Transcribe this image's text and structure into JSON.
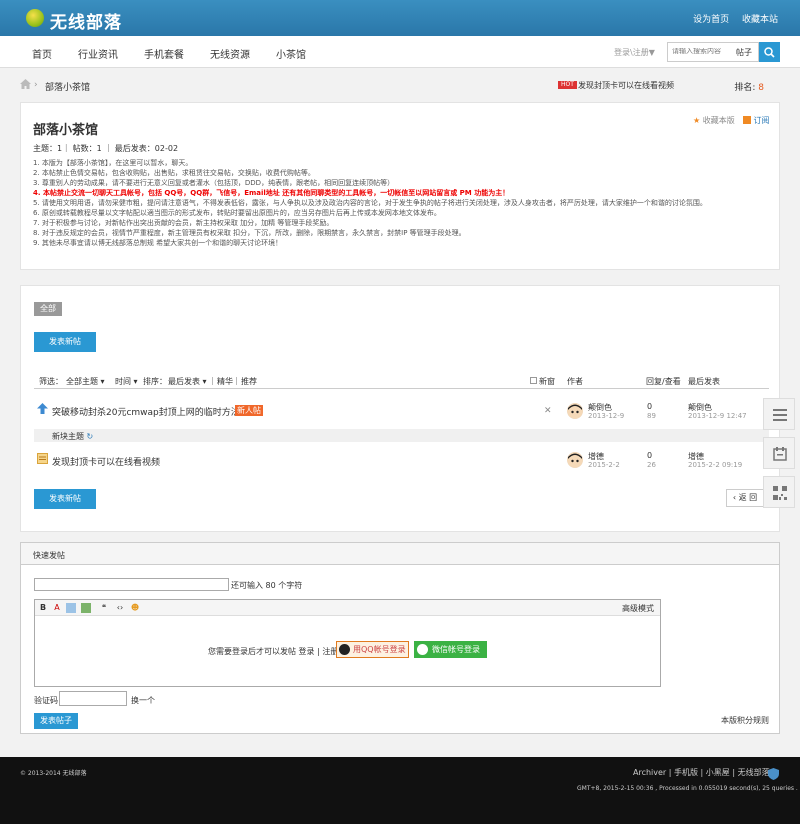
{
  "header": {
    "logo_text": "无线部落",
    "set_home": "设为首页",
    "favorite": "收藏本站"
  },
  "nav": {
    "items": [
      "首页",
      "行业资讯",
      "手机套餐",
      "无线资源",
      "小茶馆"
    ],
    "login_select": "登录\\注册▼",
    "search_placeholder": "请输入搜索内容",
    "search_type": "帖子"
  },
  "breadcrumb": {
    "sep": "›",
    "forum": "部落小茶馆"
  },
  "hot": {
    "badge": "HOT",
    "text": "发现封顶卡可以在线看视频"
  },
  "rank": {
    "label": "排名:",
    "value": "8"
  },
  "forum": {
    "title": "部落小茶馆",
    "fav": "收藏本版",
    "rss": "订阅",
    "stats": "主题：1｜ 帖数：1 ｜ 最后发表：02-02",
    "rules": [
      "1. 本版为【部落小茶馆】，在这里可以暂水，聊天。",
      "2. 本帖禁止色情交易帖，包含收购贴，出售贴，求租赁往交易帖，交换贴，收费代购帖等。",
      "3. 尊重别人的劳动成果，请不要进行无意义回复或者灌水（包括顶，DDD，纯表情，跟老帖，相同回复连续顶帖等）",
      "4. 本帖禁止交流一切聊天工具帐号，包括 QQ号，QQ群，飞信号，Email地址 还有其他同聊类型的工具帐号，一切帐信至以网站留言或 PM 功能为主！",
      "5. 请使用文明用语，请勿采健市粗，提问请注意语气，不得发表低俗，露张，与人争执以及涉及政治内容的言论，对于发生争执的帖子将进行关闭处理，涉及人身攻击者，将严厉处理，请大家维护一个和谐的讨论氛围。",
      "6. 原创或转载教程尽量以文字帖配以適当图示的形式发布，转贴时要留出原图片的，应当另存图片后再上传或本发网本地文体发布。",
      "7. 对于积极参与讨论，对新帖作出突出贡献的会员，新主持权采取 加分，加精 等管理手段奖励。",
      "8. 对于违反规定的会员，视情节严重程度，新主管理员有权采取 扣分，下沉，所改，删除，限期禁言，永久禁言，封禁IP 等管理手段处理。",
      "9. 其他未尽事宜请以博无线部落总制规 希望大家共创一个和谐的聊天讨论环境！"
    ]
  },
  "threads": {
    "tab_all": "全部",
    "post_button": "发表新帖",
    "filters": {
      "filter": "筛选：",
      "all_topics": "全部主题 ▾",
      "time": "时间 ▾",
      "sort": "排序：",
      "last_post": "最后发表 ▾",
      "digest": "精华",
      "recommend": "推荐",
      "new_window": "新窗",
      "author": "作者",
      "replies_views": "回复/查看",
      "last": "最后发表"
    },
    "pinned": {
      "title": "突破移动封杀20元cmwap封顶上网的临时方法",
      "badge": "新人帖",
      "close": "✕",
      "author": "颠倒色",
      "date": "2013-12-9",
      "replies": "0",
      "views": "89",
      "last_author": "颠倒色",
      "last_time": "2013-12-9 12:47"
    },
    "divider": "新块主题",
    "rows": [
      {
        "title": "发现封顶卡可以在线看视频",
        "author": "增德",
        "date": "2015-2-2",
        "replies": "0",
        "views": "26",
        "last_author": "增德",
        "last_time": "2015-2-2 09:19"
      }
    ],
    "back": "‹ 返 回"
  },
  "quick": {
    "title": "快速发帖",
    "subject_hint": "还可输入 80 个字符",
    "adv_mode": "高级模式",
    "editor_msg": "您需要登录后才可以发帖 登录 | 注册",
    "qq_login": "用QQ帐号登录",
    "wx_login": "微信帐号登录",
    "captcha_label": "验证码",
    "captcha_change": "换一个",
    "submit": "发表帖子",
    "rules_link": "本版积分规则"
  },
  "footer": {
    "copyright": "© 2013-2014 无线部落",
    "links": "Archiver | 手机版 | 小黑屋 | 无线部落",
    "gmt": "GMT+8, 2015-2-15 00:36 , Processed in 0.055019 second(s), 25 queries ."
  }
}
